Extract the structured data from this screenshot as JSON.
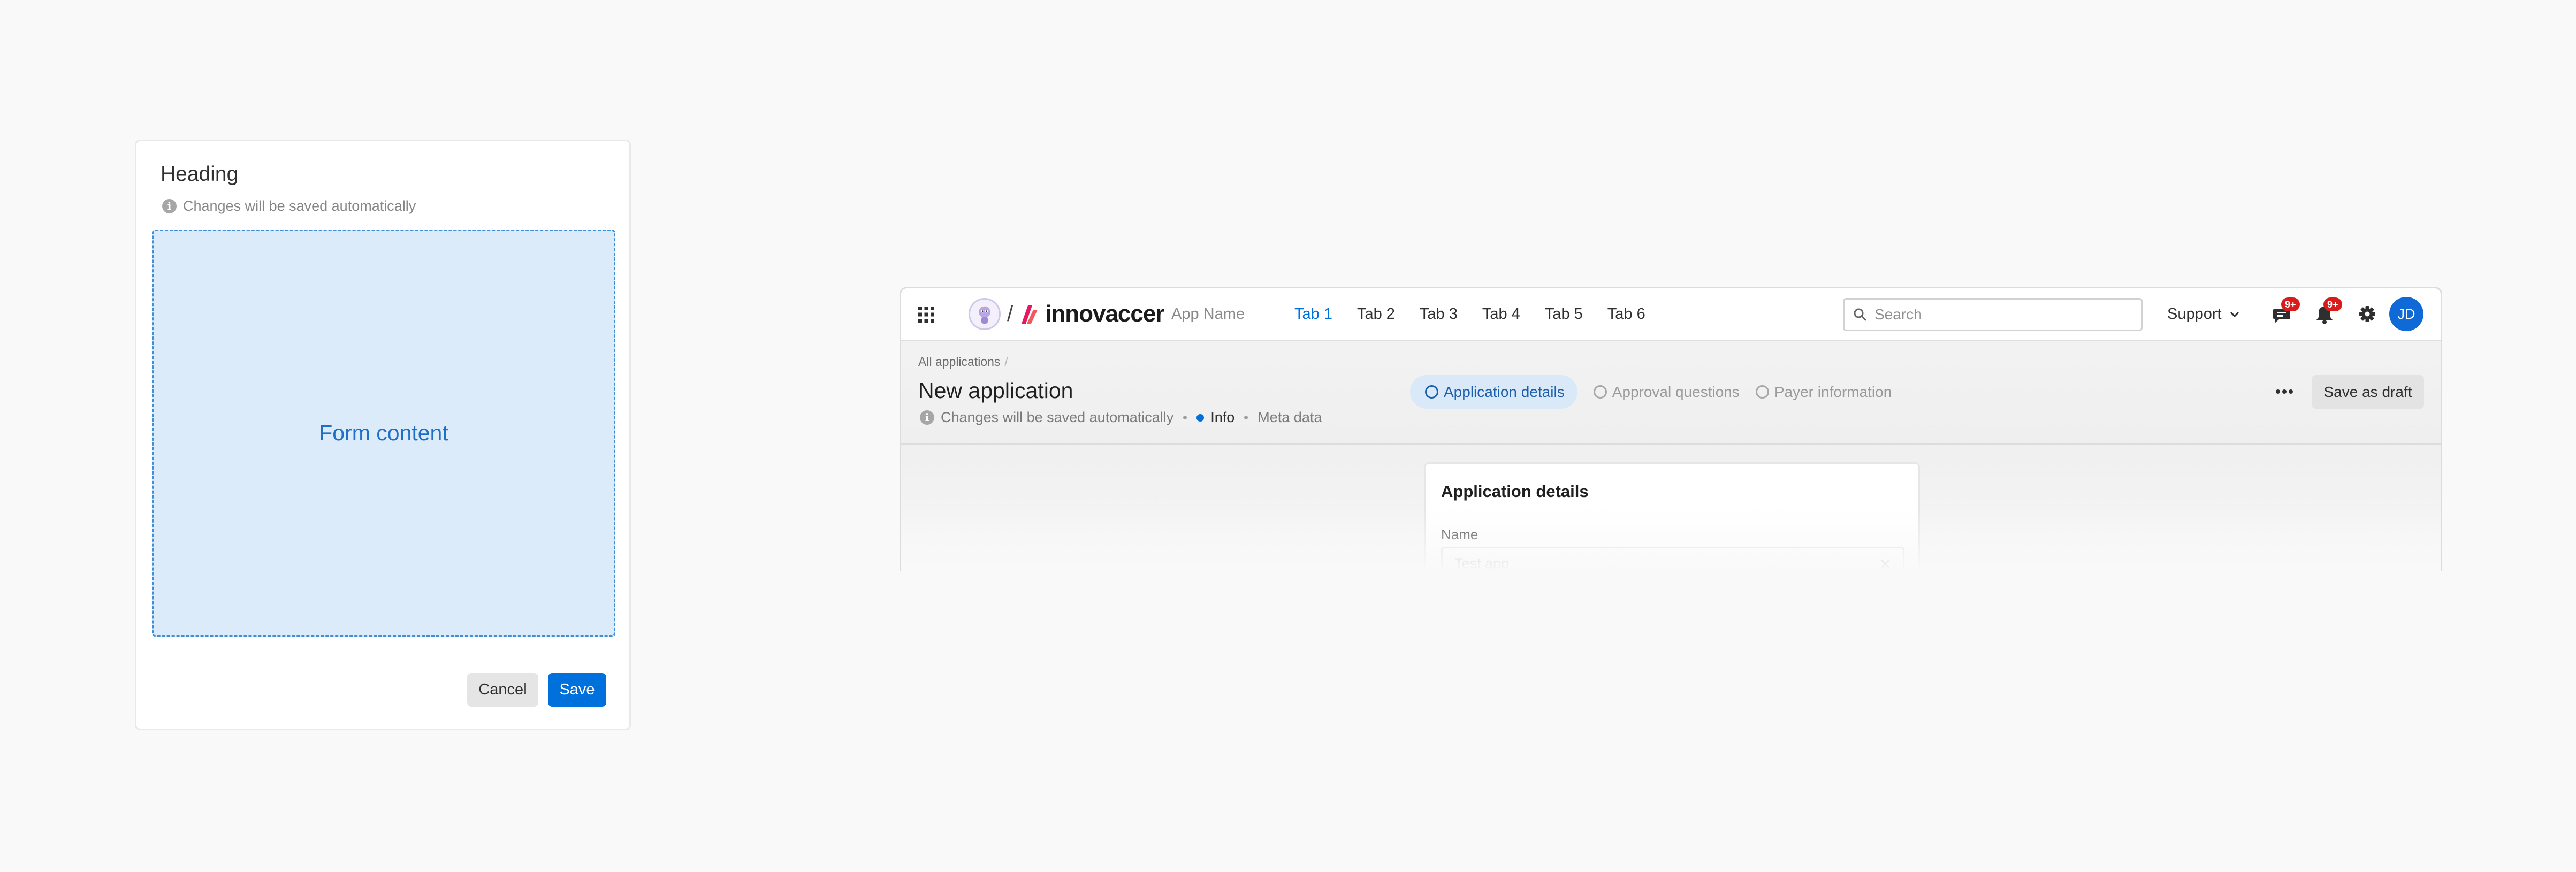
{
  "card": {
    "heading": "Heading",
    "subtitle": "Changes will be saved automatically",
    "dropzone_label": "Form content",
    "cancel_label": "Cancel",
    "save_label": "Save"
  },
  "app": {
    "logo_text": "innovaccer",
    "app_name": "App Name",
    "tabs": [
      {
        "label": "Tab 1",
        "active": true
      },
      {
        "label": "Tab 2",
        "active": false
      },
      {
        "label": "Tab 3",
        "active": false
      },
      {
        "label": "Tab 4",
        "active": false
      },
      {
        "label": "Tab 5",
        "active": false
      },
      {
        "label": "Tab 6",
        "active": false
      }
    ],
    "search_placeholder": "Search",
    "support_label": "Support",
    "messages_badge": "9+",
    "notifications_badge": "9+",
    "avatar_initials": "JD",
    "breadcrumb": "All applications",
    "page_title": "New application",
    "autosave_text": "Changes will be saved automatically",
    "meta_info": "Info",
    "meta_data": "Meta data",
    "steps": [
      {
        "label": "Application details",
        "active": true
      },
      {
        "label": "Approval questions",
        "active": false
      },
      {
        "label": "Payer information",
        "active": false
      }
    ],
    "save_draft_label": "Save as draft",
    "detail_card": {
      "title": "Application details",
      "name_label": "Name",
      "name_value": "Test app"
    }
  },
  "colors": {
    "primary": "#0070dd",
    "badge": "#d91b1b",
    "dropzone_fill": "#dcebf9"
  }
}
